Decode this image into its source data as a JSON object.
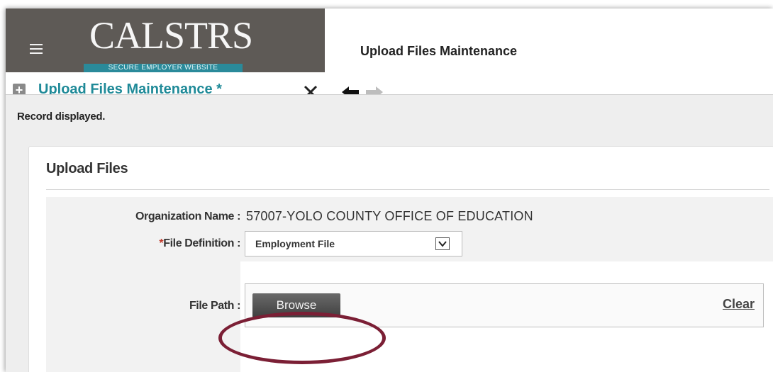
{
  "header": {
    "logo_text": "CALSTRS",
    "logo_subtitle": "SECURE EMPLOYER WEBSITE",
    "page_title": "Upload Files Maintenance",
    "logo_bg_color": "#5e5a56"
  },
  "tabbar": {
    "add_icon": "plus-icon",
    "tab_label": "Upload Files Maintenance *",
    "close_icon": "close-icon",
    "back_icon": "arrow-left-icon",
    "forward_icon": "arrow-right-icon",
    "accent_color": "#1f8a98"
  },
  "status": {
    "message": "Record displayed."
  },
  "panel": {
    "title": "Upload Files",
    "fields": {
      "organization_name_label": "Organization Name :",
      "organization_name_value": "57007-YOLO COUNTY OFFICE OF EDUCATION",
      "file_definition_required_mark": "*",
      "file_definition_label": "File Definition :",
      "file_definition_value": "Employment File",
      "file_path_label": "File Path :",
      "browse_label": "Browse",
      "clear_label": "Clear"
    }
  },
  "annotation": {
    "highlight_color": "#7b1f35"
  }
}
